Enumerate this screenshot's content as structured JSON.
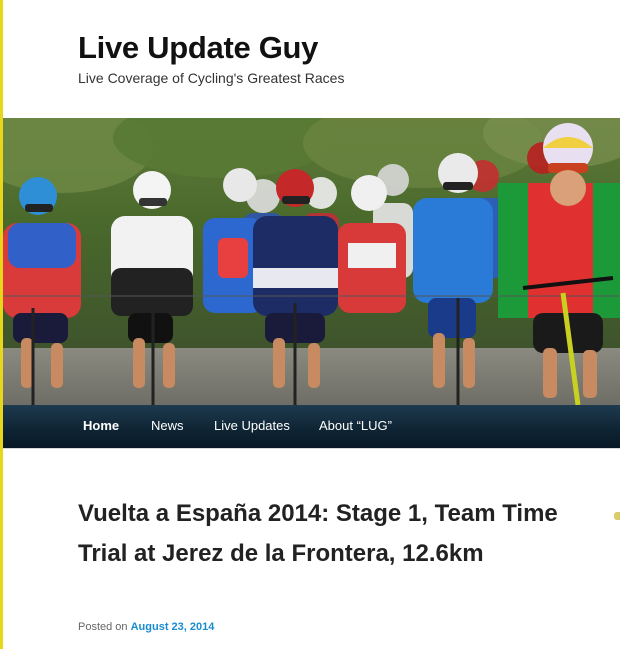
{
  "site": {
    "title": "Live Update Guy",
    "tagline": "Live Coverage of Cycling's Greatest Races"
  },
  "header_image": {
    "icon": "cycling-peloton-photo"
  },
  "nav": {
    "items": [
      {
        "label": "Home",
        "active": true
      },
      {
        "label": "News",
        "active": false
      },
      {
        "label": "Live Updates",
        "active": false
      },
      {
        "label": "About “LUG”",
        "active": false
      }
    ]
  },
  "post": {
    "title": "Vuelta a España 2014: Stage 1, Team Time Trial at Jerez de la Frontera, 12.6km",
    "posted_on_label": "Posted on",
    "date": "August 23, 2014"
  },
  "colors": {
    "accent_link": "#1b8bd0",
    "nav_background": "#0f2535",
    "left_rule": "#e8d61a"
  }
}
